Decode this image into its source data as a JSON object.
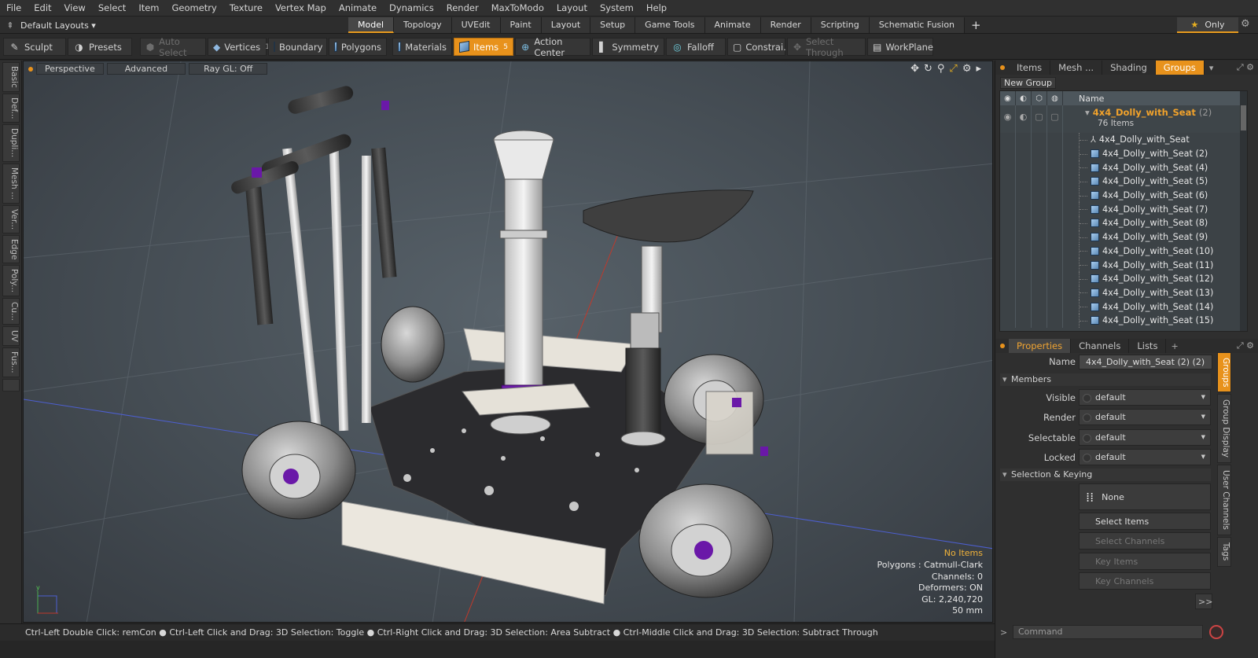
{
  "menu": [
    "File",
    "Edit",
    "View",
    "Select",
    "Item",
    "Geometry",
    "Texture",
    "Vertex Map",
    "Animate",
    "Dynamics",
    "Render",
    "MaxToModo",
    "Layout",
    "System",
    "Help"
  ],
  "layout_selector": "Default Layouts ▾",
  "tabs": [
    "Model",
    "Topology",
    "UVEdit",
    "Paint",
    "Layout",
    "Setup",
    "Game Tools",
    "Animate",
    "Render",
    "Scripting",
    "Schematic Fusion"
  ],
  "active_tab": "Model",
  "only_label": "Only",
  "toolbar": {
    "sculpt": "Sculpt",
    "presets": "Presets",
    "auto_select": "Auto Select",
    "vertices": "Vertices",
    "vertices_num": "1",
    "boundary": "Boundary",
    "polygons": "Polygons",
    "materials": "Materials",
    "items": "Items",
    "items_num": "5",
    "action_center": "Action Center",
    "symmetry": "Symmetry",
    "falloff": "Falloff",
    "constrain": "Constrai...",
    "select_through": "Select Through",
    "workplane": "WorkPlane"
  },
  "left_tabs": [
    "Basic",
    "Def...",
    "Dupli...",
    "Mesh ...",
    "Ver...",
    "Edge",
    "Poly...",
    "Cu...",
    "UV",
    "Fus..."
  ],
  "viewport": {
    "perspective": "Perspective",
    "advanced": "Advanced",
    "raygl": "Ray GL: Off",
    "info": {
      "no_items": "No Items",
      "polygons": "Polygons : Catmull-Clark",
      "channels": "Channels: 0",
      "deformers": "Deformers: ON",
      "gl": "GL: 2,240,720",
      "scale": "50 mm"
    }
  },
  "status": "Ctrl-Left Double Click: remCon ● Ctrl-Left Click and Drag: 3D Selection: Toggle ● Ctrl-Right Click and Drag: 3D Selection: Area Subtract ● Ctrl-Middle Click and Drag: 3D Selection: Subtract Through",
  "panel_tabs": [
    "Items",
    "Mesh ...",
    "Shading",
    "Groups"
  ],
  "new_group": "New Group",
  "tree": {
    "name_header": "Name",
    "group_name": "4x4_Dolly_with_Seat",
    "group_count": "(2)",
    "group_sub": "76 Items",
    "items": [
      "4x4_Dolly_with_Seat",
      "4x4_Dolly_with_Seat (2)",
      "4x4_Dolly_with_Seat (4)",
      "4x4_Dolly_with_Seat (5)",
      "4x4_Dolly_with_Seat (6)",
      "4x4_Dolly_with_Seat (7)",
      "4x4_Dolly_with_Seat (8)",
      "4x4_Dolly_with_Seat (9)",
      "4x4_Dolly_with_Seat (10)",
      "4x4_Dolly_with_Seat (11)",
      "4x4_Dolly_with_Seat (12)",
      "4x4_Dolly_with_Seat (13)",
      "4x4_Dolly_with_Seat (14)",
      "4x4_Dolly_with_Seat (15)"
    ]
  },
  "prop_tabs": [
    "Properties",
    "Channels",
    "Lists"
  ],
  "props": {
    "name_label": "Name",
    "name_value": "4x4_Dolly_with_Seat (2) (2)",
    "members": "Members",
    "visible_label": "Visible",
    "render_label": "Render",
    "selectable_label": "Selectable",
    "locked_label": "Locked",
    "default": "default",
    "sel_keying": "Selection & Keying",
    "none": "None",
    "select_items": "Select Items",
    "select_channels": "Select Channels",
    "key_items": "Key Items",
    "key_channels": "Key Channels",
    "more": ">>"
  },
  "side_tabs": [
    "Groups",
    "Group Display",
    "User Channels",
    "Tags"
  ],
  "command_placeholder": "Command",
  "colors": {
    "accent": "#e8921c",
    "purple": "#6a18a8"
  }
}
